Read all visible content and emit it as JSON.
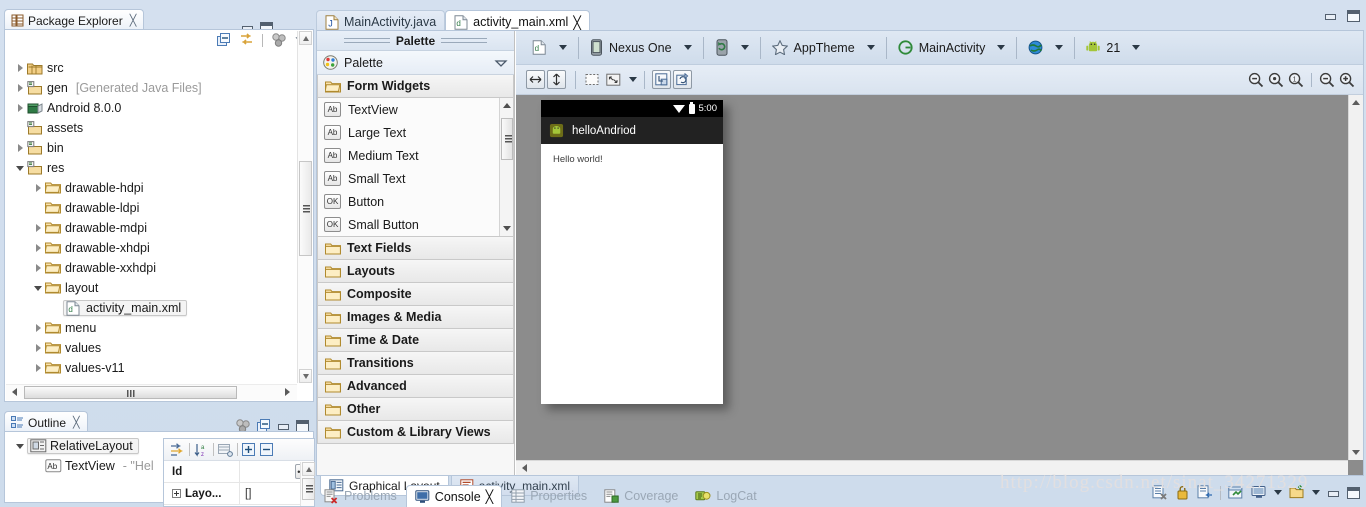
{
  "package_explorer": {
    "tab_label": "Package Explorer",
    "toolbar": [
      "collapse-all-icon",
      "link-with-editor-icon",
      "view-menu-icon",
      "view-chevron-icon"
    ],
    "tree": [
      {
        "label": "src",
        "dim": "",
        "indent": 0,
        "twisty": "closed",
        "icon": "package-folder-icon",
        "selected": false
      },
      {
        "label": "gen",
        "dim": "[Generated Java Files]",
        "indent": 0,
        "twisty": "closed",
        "icon": "source-folder-icon",
        "selected": false
      },
      {
        "label": "Android 8.0.0",
        "dim": "",
        "indent": 0,
        "twisty": "closed",
        "icon": "library-icon",
        "selected": false
      },
      {
        "label": "assets",
        "dim": "",
        "indent": 0,
        "twisty": "none",
        "icon": "source-folder-icon",
        "selected": false
      },
      {
        "label": "bin",
        "dim": "",
        "indent": 0,
        "twisty": "closed",
        "icon": "source-folder-icon",
        "selected": false
      },
      {
        "label": "res",
        "dim": "",
        "indent": 0,
        "twisty": "open",
        "icon": "source-folder-icon",
        "selected": false
      },
      {
        "label": "drawable-hdpi",
        "dim": "",
        "indent": 1,
        "twisty": "closed",
        "icon": "folder-icon",
        "selected": false
      },
      {
        "label": "drawable-ldpi",
        "dim": "",
        "indent": 1,
        "twisty": "none",
        "icon": "folder-icon",
        "selected": false
      },
      {
        "label": "drawable-mdpi",
        "dim": "",
        "indent": 1,
        "twisty": "closed",
        "icon": "folder-icon",
        "selected": false
      },
      {
        "label": "drawable-xhdpi",
        "dim": "",
        "indent": 1,
        "twisty": "closed",
        "icon": "folder-icon",
        "selected": false
      },
      {
        "label": "drawable-xxhdpi",
        "dim": "",
        "indent": 1,
        "twisty": "closed",
        "icon": "folder-icon",
        "selected": false
      },
      {
        "label": "layout",
        "dim": "",
        "indent": 1,
        "twisty": "open",
        "icon": "folder-icon",
        "selected": false
      },
      {
        "label": "activity_main.xml",
        "dim": "",
        "indent": 2,
        "twisty": "none",
        "icon": "xml-file-icon",
        "selected": true
      },
      {
        "label": "menu",
        "dim": "",
        "indent": 1,
        "twisty": "closed",
        "icon": "folder-icon",
        "selected": false
      },
      {
        "label": "values",
        "dim": "",
        "indent": 1,
        "twisty": "closed",
        "icon": "folder-icon",
        "selected": false
      },
      {
        "label": "values-v11",
        "dim": "",
        "indent": 1,
        "twisty": "closed",
        "icon": "folder-icon",
        "selected": false
      }
    ]
  },
  "outline": {
    "tab_label": "Outline",
    "toolbar": [
      "view-menu-icon",
      "collapse-all-icon"
    ],
    "tree": [
      {
        "label": "RelativeLayout",
        "dim": "",
        "indent": 0,
        "twisty": "open",
        "icon": "relative-layout-icon",
        "selected": true
      },
      {
        "label": "TextView",
        "dim": "- \"Hel",
        "indent": 1,
        "twisty": "none",
        "icon": "textview-icon",
        "selected": false
      }
    ]
  },
  "properties": {
    "toolbar": [
      "show-advanced-icon",
      "sort-alpha-icon",
      "default-properties-icon",
      "expand-all-icon",
      "collapse-all-icon"
    ],
    "rows": [
      {
        "name": "Id",
        "value": "",
        "expandable": false,
        "has_ellipsis": true
      },
      {
        "name": "Layo...",
        "value": "[]",
        "expandable": true,
        "has_ellipsis": false
      }
    ]
  },
  "editor": {
    "tabs": [
      {
        "label": "MainActivity.java",
        "icon": "java-file-icon",
        "active": false,
        "closable": false
      },
      {
        "label": "activity_main.xml",
        "icon": "xml-file-icon",
        "active": true,
        "closable": true
      }
    ],
    "window_buttons": [
      "minimize-icon",
      "maximize-icon"
    ],
    "bottom_tabs": [
      {
        "label": "Graphical Layout",
        "icon": "graphical-layout-icon",
        "active": true
      },
      {
        "label": "activity_main.xml",
        "icon": "xml-source-icon",
        "active": false
      }
    ]
  },
  "palette": {
    "grip_label": "Palette",
    "header_label": "Palette",
    "header_icon": "palette-icon",
    "groups": [
      {
        "label": "Form Widgets",
        "icon": "open-folder-icon",
        "expanded": true,
        "items": [
          {
            "label": "TextView",
            "icon": "Ab"
          },
          {
            "label": "Large Text",
            "icon": "Ab"
          },
          {
            "label": "Medium Text",
            "icon": "Ab"
          },
          {
            "label": "Small Text",
            "icon": "Ab"
          },
          {
            "label": "Button",
            "icon": "OK"
          },
          {
            "label": "Small Button",
            "icon": "OK"
          }
        ]
      },
      {
        "label": "Text Fields",
        "icon": "closed-folder-icon",
        "expanded": false,
        "items": []
      },
      {
        "label": "Layouts",
        "icon": "closed-folder-icon",
        "expanded": false,
        "items": []
      },
      {
        "label": "Composite",
        "icon": "closed-folder-icon",
        "expanded": false,
        "items": []
      },
      {
        "label": "Images & Media",
        "icon": "closed-folder-icon",
        "expanded": false,
        "items": []
      },
      {
        "label": "Time & Date",
        "icon": "closed-folder-icon",
        "expanded": false,
        "items": []
      },
      {
        "label": "Transitions",
        "icon": "closed-folder-icon",
        "expanded": false,
        "items": []
      },
      {
        "label": "Advanced",
        "icon": "closed-folder-icon",
        "expanded": false,
        "items": []
      },
      {
        "label": "Other",
        "icon": "closed-folder-icon",
        "expanded": false,
        "items": []
      },
      {
        "label": "Custom & Library Views",
        "icon": "closed-folder-icon",
        "expanded": false,
        "items": []
      }
    ]
  },
  "config_bar": {
    "items": [
      {
        "label": "",
        "icon": "config-file-icon",
        "caret": true
      },
      {
        "label": "Nexus One",
        "icon": "device-icon",
        "caret": true
      },
      {
        "label": "",
        "icon": "orientation-icon",
        "caret": true
      },
      {
        "label": "AppTheme",
        "icon": "theme-star-icon",
        "caret": true
      },
      {
        "label": "MainActivity",
        "icon": "activity-icon",
        "caret": true
      },
      {
        "label": "",
        "icon": "locale-globe-icon",
        "caret": true
      },
      {
        "label": "21",
        "icon": "android-robot-icon",
        "caret": true
      }
    ]
  },
  "layout_toolbar": {
    "left_buttons": [
      "toggle-width-icon",
      "toggle-height-icon"
    ],
    "mid_buttons": [
      "marquee-select-icon",
      "expand-layout-icon",
      "expand-menu-caret"
    ],
    "right_buttons": [
      "outline-toggle-icon",
      "refresh-render-icon"
    ],
    "zoom_buttons": [
      "zoom-fit-icon",
      "zoom-to-fit-icon",
      "zoom-actual-size-icon",
      "zoom-out-icon",
      "zoom-in-icon"
    ]
  },
  "preview": {
    "status_time": "5:00",
    "status_icons": [
      "wifi-icon",
      "battery-icon"
    ],
    "app_title": "helloAndriod",
    "app_icon": "android-launcher-icon",
    "content_text": "Hello world!"
  },
  "bottom_view": {
    "tabs": [
      {
        "label": "Problems",
        "icon": "problems-icon",
        "active": false,
        "closable": false
      },
      {
        "label": "Console",
        "icon": "console-icon",
        "active": true,
        "closable": true
      },
      {
        "label": "Properties",
        "icon": "properties-icon",
        "active": false,
        "closable": false
      },
      {
        "label": "Coverage",
        "icon": "coverage-icon",
        "active": false,
        "closable": false
      },
      {
        "label": "LogCat",
        "icon": "logcat-icon",
        "active": false,
        "closable": false
      }
    ],
    "toolbar": [
      "clear-console-icon",
      "lock-scroll-icon",
      "show-console-icon",
      "pin-console-icon",
      "display-console-icon",
      "display-caret-icon",
      "open-console-icon",
      "open-caret-icon",
      "minimize-icon",
      "maximize-icon"
    ]
  },
  "watermark": "http://blog.csdn.net/sinat_34271329",
  "colors": {
    "chrome": "#cfdced",
    "canvas_bg": "#8c8c8c",
    "action_bar": "#222222",
    "panel_border": "#b6c6da"
  }
}
